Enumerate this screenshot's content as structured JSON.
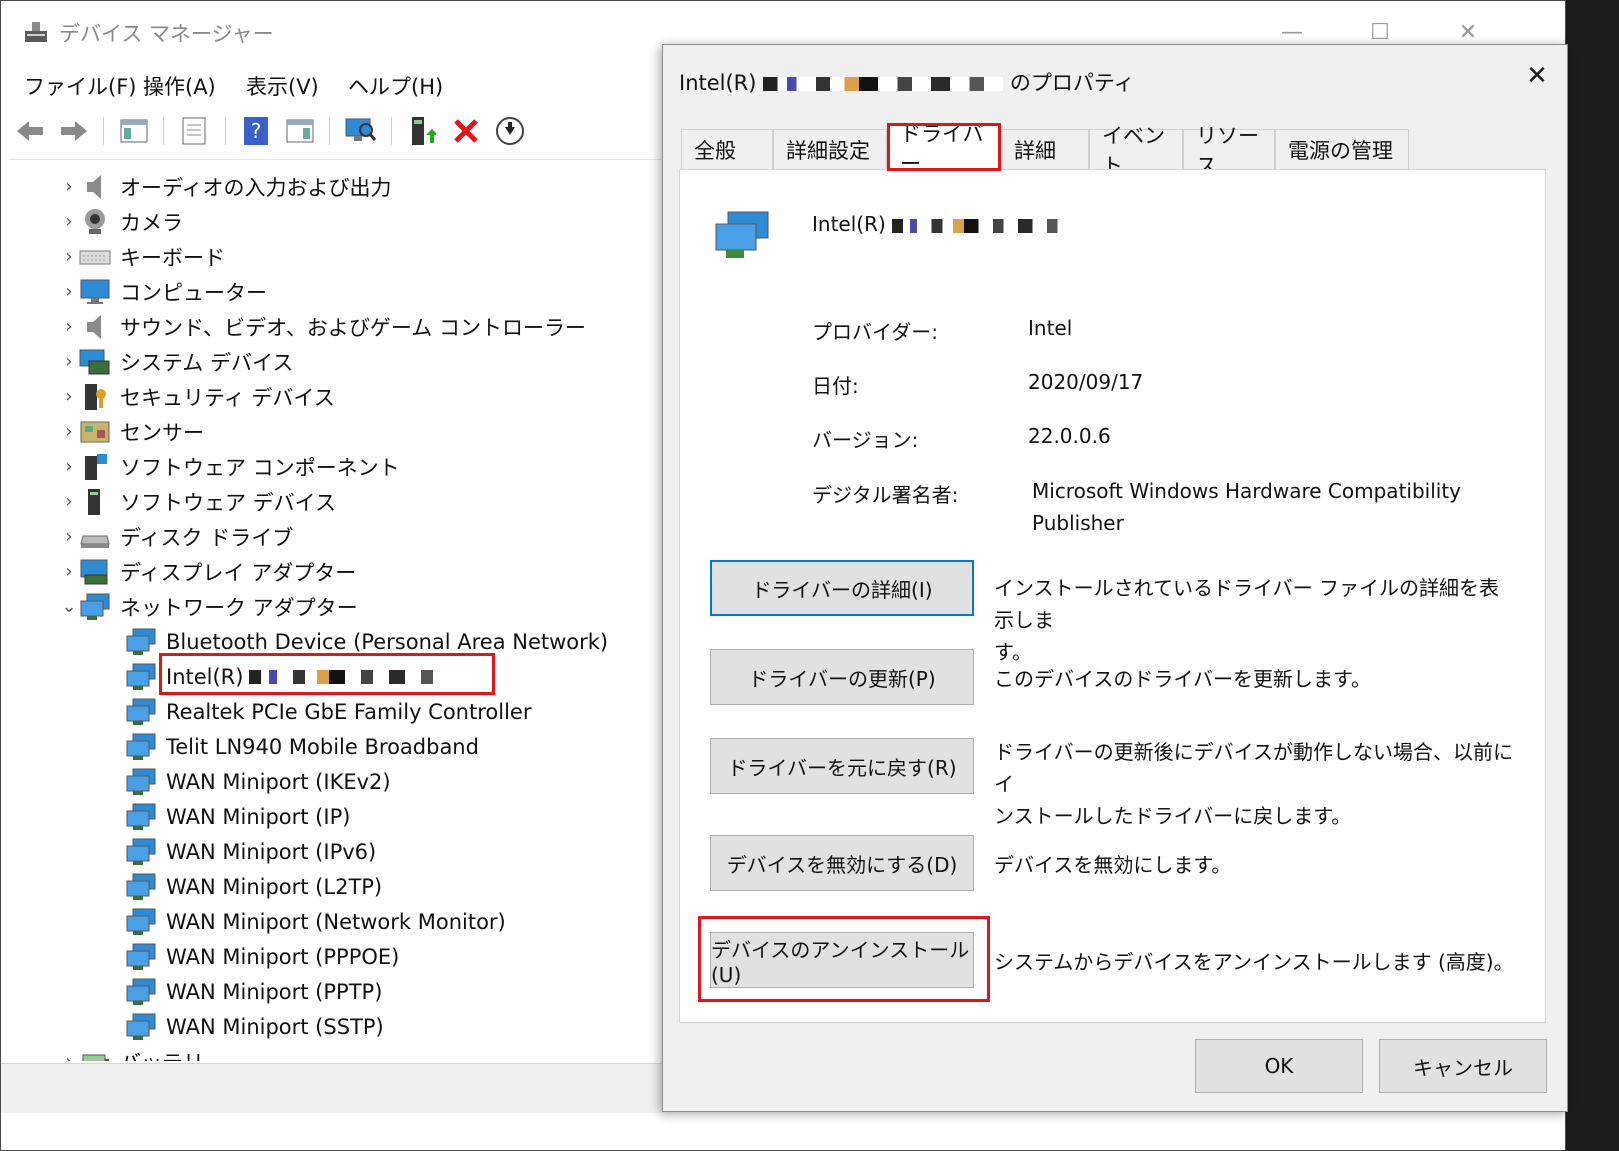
{
  "device_manager": {
    "title": "デバイス マネージャー",
    "controls": {
      "minimize": "—",
      "maximize": "☐",
      "close": "✕"
    },
    "menu": [
      "ファイル(F)",
      "操作(A)",
      "表示(V)",
      "ヘルプ(H)"
    ],
    "toolbar_icons": [
      "back-icon",
      "forward-icon",
      "show-hide-console-tree-icon",
      "properties-icon",
      "help-icon",
      "action-pane-icon",
      "scan-hardware-icon",
      "update-driver-icon",
      "uninstall-device-icon",
      "disable-device-icon"
    ],
    "tree": {
      "categories": [
        "オーディオの入力および出力",
        "カメラ",
        "キーボード",
        "コンピューター",
        "サウンド、ビデオ、およびゲーム コントローラー",
        "システム デバイス",
        "セキュリティ デバイス",
        "センサー",
        "ソフトウェア コンポーネント",
        "ソフトウェア デバイス",
        "ディスク ドライブ",
        "ディスプレイ アダプター",
        "ネットワーク アダプター"
      ],
      "network_adapters": [
        "Bluetooth Device (Personal Area Network)",
        "Intel(R)",
        "Realtek PCIe GbE Family Controller",
        "Telit LN940 Mobile Broadband",
        "WAN Miniport (IKEv2)",
        "WAN Miniport (IP)",
        "WAN Miniport (IPv6)",
        "WAN Miniport (L2TP)",
        "WAN Miniport (Network Monitor)",
        "WAN Miniport (PPPOE)",
        "WAN Miniport (PPTP)",
        "WAN Miniport (SSTP)"
      ],
      "partial_next_category": "バッテリ"
    }
  },
  "dialog": {
    "title_prefix": "Intel(R)",
    "title_suffix": "のプロパティ",
    "close": "✕",
    "tabs": [
      "全般",
      "詳細設定",
      "ドライバー",
      "詳細",
      "イベント",
      "リソース",
      "電源の管理"
    ],
    "active_tab": "ドライバー",
    "device_name": "Intel(R)",
    "info": {
      "provider_label": "プロバイダー:",
      "provider_value": "Intel",
      "date_label": "日付:",
      "date_value": "2020/09/17",
      "version_label": "バージョン:",
      "version_value": "22.0.0.6",
      "signer_label": "デジタル署名者:",
      "signer_value_line1": "Microsoft Windows Hardware Compatibility",
      "signer_value_line2": "Publisher"
    },
    "actions": [
      {
        "button": "ドライバーの詳細(I)",
        "desc_line1": "インストールされているドライバー ファイルの詳細を表示しま",
        "desc_line2": "す。"
      },
      {
        "button": "ドライバーの更新(P)",
        "desc_line1": "このデバイスのドライバーを更新します。",
        "desc_line2": ""
      },
      {
        "button": "ドライバーを元に戻す(R)",
        "desc_line1": "ドライバーの更新後にデバイスが動作しない場合、以前にイ",
        "desc_line2": "ンストールしたドライバーに戻します。"
      },
      {
        "button": "デバイスを無効にする(D)",
        "desc_line1": "デバイスを無効にします。",
        "desc_line2": ""
      },
      {
        "button": "デバイスのアンインストール(U)",
        "desc_line1": "システムからデバイスをアンインストールします (高度)。",
        "desc_line2": ""
      }
    ],
    "ok": "OK",
    "cancel": "キャンセル"
  },
  "colors": {
    "highlight_red": "#e0161c",
    "focus_blue": "#0078d7",
    "network_icon": "#2e8bd6"
  }
}
